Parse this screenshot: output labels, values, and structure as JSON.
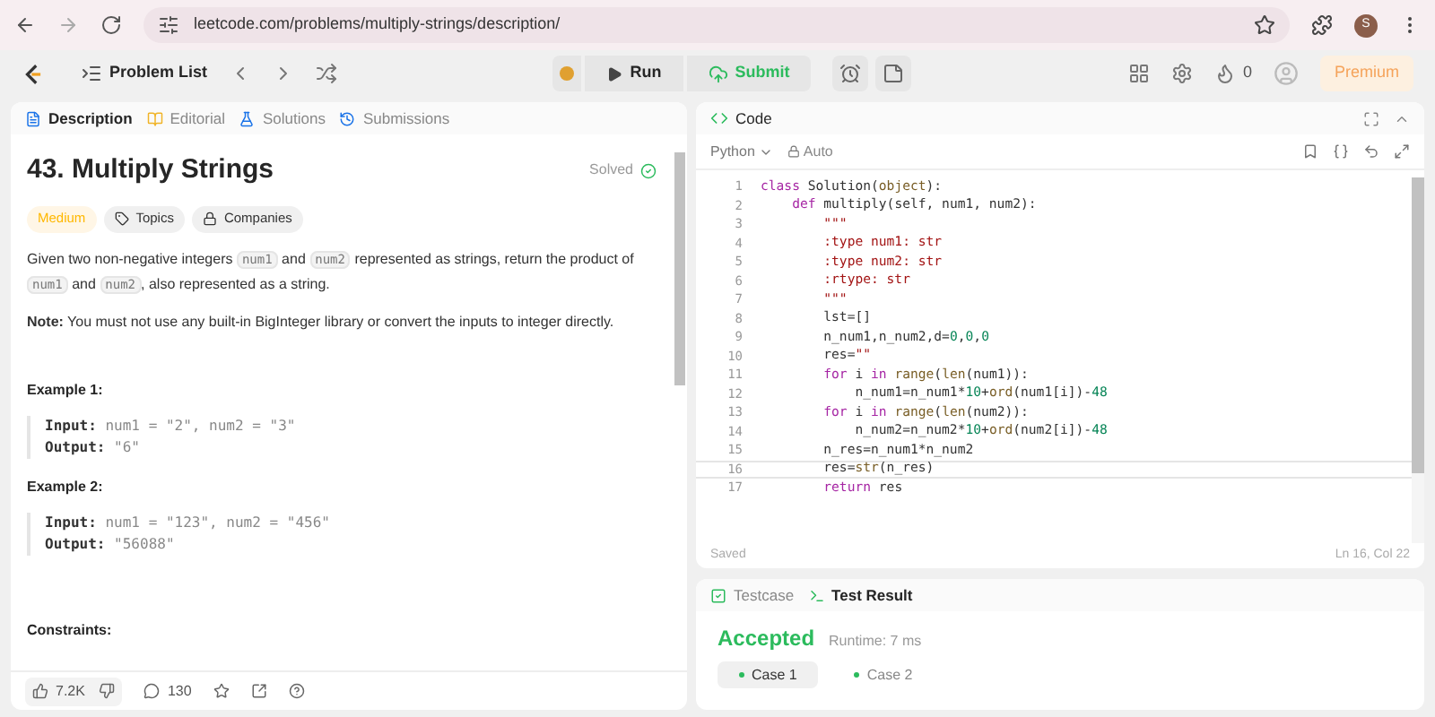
{
  "browser": {
    "url": "leetcode.com/problems/multiply-strings/description/",
    "profile_initial": "S"
  },
  "toolbar": {
    "problem_list": "Problem List",
    "run": "Run",
    "submit": "Submit",
    "streak": "0",
    "premium": "Premium"
  },
  "left_tabs": [
    {
      "label": "Description",
      "selected": true
    },
    {
      "label": "Editorial",
      "selected": false
    },
    {
      "label": "Solutions",
      "selected": false
    },
    {
      "label": "Submissions",
      "selected": false
    }
  ],
  "problem": {
    "title": "43. Multiply Strings",
    "status": "Solved",
    "tags": [
      {
        "label": "Medium",
        "kind": "difficulty"
      },
      {
        "label": "Topics",
        "kind": "topics"
      },
      {
        "label": "Companies",
        "kind": "companies"
      }
    ],
    "statement": [
      {
        "text": "Given two non-negative integers ",
        "code": false
      },
      {
        "text": "num1",
        "code": true
      },
      {
        "text": " and ",
        "code": false
      },
      {
        "text": "num2",
        "code": true
      },
      {
        "text": " represented as strings, return the product of ",
        "code": false
      },
      {
        "text": "num1",
        "code": true
      },
      {
        "text": " and ",
        "code": false
      },
      {
        "text": "num2",
        "code": true
      },
      {
        "text": ", also represented as a string.",
        "code": false
      }
    ],
    "note": "**Note:** You must not use any built-in BigInteger library or convert the inputs to integer directly.",
    "examples": [
      {
        "title": "Example 1:",
        "lines": [
          {
            "label": "Input:",
            "value": "num1 = \"2\", num2 = \"3\""
          },
          {
            "label": "Output:",
            "value": "\"6\""
          }
        ]
      },
      {
        "title": "Example 2:",
        "lines": [
          {
            "label": "Input:",
            "value": "num1 = \"123\", num2 = \"456\""
          },
          {
            "label": "Output:",
            "value": "\"56088\""
          }
        ]
      }
    ],
    "constraints_title": "Constraints:"
  },
  "footer": {
    "likes": "7.2K",
    "comments": "130"
  },
  "code_panel": {
    "title": "Code",
    "language": "Python",
    "mode": "Auto",
    "status": "Saved",
    "cursor": "Ln 16, Col 22",
    "lines": [
      {
        "n": "1",
        "current": false,
        "tokens": [
          {
            "t": "class ",
            "kind": "keyword"
          },
          {
            "t": "Solution(",
            "kind": "plain"
          },
          {
            "t": "object",
            "kind": "builtin"
          },
          {
            "t": "):",
            "kind": "plain"
          }
        ]
      },
      {
        "n": "2",
        "current": false,
        "tokens": [
          {
            "t": "    def ",
            "kind": "keyword"
          },
          {
            "t": "multiply(self, num1, num2):",
            "kind": "plain"
          }
        ]
      },
      {
        "n": "3",
        "current": false,
        "tokens": [
          {
            "t": "        \"\"\"",
            "kind": "string"
          }
        ]
      },
      {
        "n": "4",
        "current": false,
        "tokens": [
          {
            "t": "        :type num1: str",
            "kind": "string"
          }
        ]
      },
      {
        "n": "5",
        "current": false,
        "tokens": [
          {
            "t": "        :type num2: str",
            "kind": "string"
          }
        ]
      },
      {
        "n": "6",
        "current": false,
        "tokens": [
          {
            "t": "        :rtype: str",
            "kind": "string"
          }
        ]
      },
      {
        "n": "7",
        "current": false,
        "tokens": [
          {
            "t": "        \"\"\"",
            "kind": "string"
          }
        ]
      },
      {
        "n": "8",
        "current": false,
        "tokens": [
          {
            "t": "        lst=[]",
            "kind": "plain"
          }
        ]
      },
      {
        "n": "9",
        "current": false,
        "tokens": [
          {
            "t": "        n_num1,n_num2,d=",
            "kind": "plain"
          },
          {
            "t": "0",
            "kind": "number"
          },
          {
            "t": ",",
            "kind": "plain"
          },
          {
            "t": "0",
            "kind": "number"
          },
          {
            "t": ",",
            "kind": "plain"
          },
          {
            "t": "0",
            "kind": "number"
          }
        ]
      },
      {
        "n": "10",
        "current": false,
        "tokens": [
          {
            "t": "        res=",
            "kind": "plain"
          },
          {
            "t": "\"\"",
            "kind": "string"
          }
        ]
      },
      {
        "n": "11",
        "current": false,
        "tokens": [
          {
            "t": "        for ",
            "kind": "keyword"
          },
          {
            "t": "i ",
            "kind": "plain"
          },
          {
            "t": "in ",
            "kind": "keyword"
          },
          {
            "t": "range",
            "kind": "builtin"
          },
          {
            "t": "(",
            "kind": "plain"
          },
          {
            "t": "len",
            "kind": "builtin"
          },
          {
            "t": "(num1)):",
            "kind": "plain"
          }
        ]
      },
      {
        "n": "12",
        "current": false,
        "tokens": [
          {
            "t": "            n_num1=n_num1*",
            "kind": "plain"
          },
          {
            "t": "10",
            "kind": "number"
          },
          {
            "t": "+",
            "kind": "plain"
          },
          {
            "t": "ord",
            "kind": "builtin"
          },
          {
            "t": "(num1[i])-",
            "kind": "plain"
          },
          {
            "t": "48",
            "kind": "number"
          }
        ]
      },
      {
        "n": "13",
        "current": false,
        "tokens": [
          {
            "t": "        for ",
            "kind": "keyword"
          },
          {
            "t": "i ",
            "kind": "plain"
          },
          {
            "t": "in ",
            "kind": "keyword"
          },
          {
            "t": "range",
            "kind": "builtin"
          },
          {
            "t": "(",
            "kind": "plain"
          },
          {
            "t": "len",
            "kind": "builtin"
          },
          {
            "t": "(num2)):",
            "kind": "plain"
          }
        ]
      },
      {
        "n": "14",
        "current": false,
        "tokens": [
          {
            "t": "            n_num2=n_num2*",
            "kind": "plain"
          },
          {
            "t": "10",
            "kind": "number"
          },
          {
            "t": "+",
            "kind": "plain"
          },
          {
            "t": "ord",
            "kind": "builtin"
          },
          {
            "t": "(num2[i])-",
            "kind": "plain"
          },
          {
            "t": "48",
            "kind": "number"
          }
        ]
      },
      {
        "n": "15",
        "current": false,
        "tokens": [
          {
            "t": "        n_res=n_num1*n_num2",
            "kind": "plain"
          }
        ]
      },
      {
        "n": "16",
        "current": true,
        "tokens": [
          {
            "t": "        res=",
            "kind": "plain"
          },
          {
            "t": "str",
            "kind": "builtin"
          },
          {
            "t": "(n_res)",
            "kind": "plain"
          }
        ]
      },
      {
        "n": "17",
        "current": false,
        "tokens": [
          {
            "t": "        return ",
            "kind": "keyword"
          },
          {
            "t": "res",
            "kind": "plain"
          }
        ]
      }
    ]
  },
  "result_tabs": [
    {
      "label": "Testcase",
      "selected": false
    },
    {
      "label": "Test Result",
      "selected": true
    }
  ],
  "result": {
    "verdict": "Accepted",
    "runtime": "Runtime: 7 ms",
    "cases": [
      {
        "label": "Case 1",
        "selected": true
      },
      {
        "label": "Case 2",
        "selected": false
      }
    ]
  }
}
